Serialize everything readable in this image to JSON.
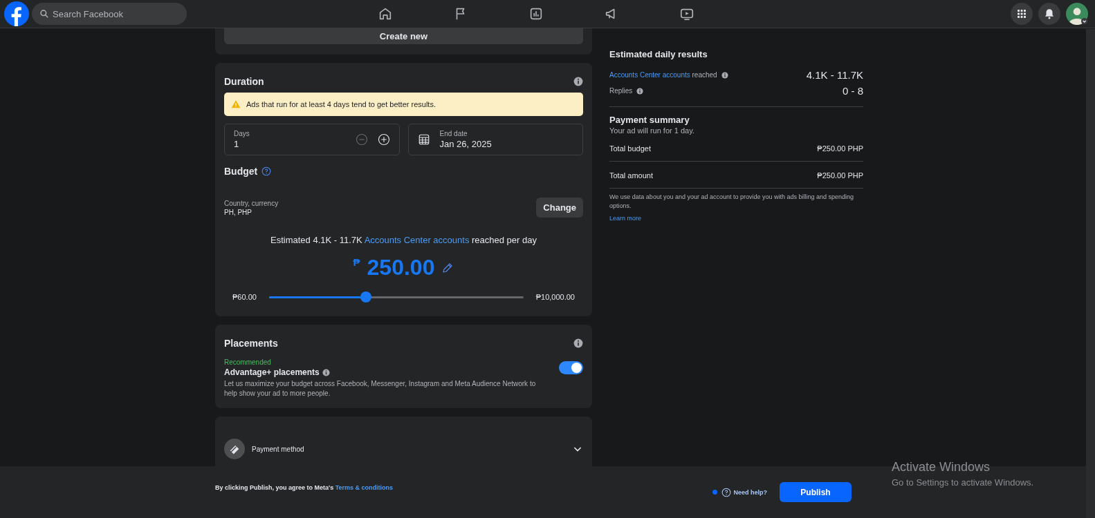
{
  "topbar": {
    "search": {
      "placeholder": "Search Facebook"
    }
  },
  "create_new_button": "Create new",
  "duration": {
    "title": "Duration",
    "warning": "Ads that run for at least 4 days tend to get better results.",
    "days": {
      "label": "Days",
      "value": "1",
      "decrement_disabled": true
    },
    "end_date": {
      "label": "End date",
      "value": "Jan 26, 2025"
    }
  },
  "budget": {
    "title": "Budget",
    "country_label": "Country, currency",
    "country_value": "PH, PHP",
    "change_button": "Change",
    "estimate": {
      "before": "Estimated 4.1K - 11.7K",
      "link": "Accounts Center accounts",
      "after": "reached per day"
    },
    "currency_symbol": "₱",
    "amount": "250.00",
    "slider": {
      "min_label": "₱60.00",
      "max_label": "₱10,000.00",
      "level": 0.38
    }
  },
  "placements": {
    "title": "Placements",
    "recommended": "Recommended",
    "option_title": "Advantage+ placements",
    "description": "Let us maximize your budget across Facebook, Messenger, Instagram and Meta Audience Network to help show your ad to more people.",
    "on": true
  },
  "payment_method": {
    "label": "Payment method"
  },
  "estimated_daily_results": {
    "title": "Estimated daily results",
    "rows": [
      {
        "link": "Accounts Center accounts",
        "label": "reached",
        "value": "4.1K - 11.7K"
      },
      {
        "label": "Replies",
        "value": "0 - 8"
      }
    ]
  },
  "payment_summary": {
    "title": "Payment summary",
    "subtitle": "Your ad will run for 1 day.",
    "rows": [
      {
        "label": "Total budget",
        "value": "₱250.00 PHP"
      },
      {
        "label": "Total amount",
        "value": "₱250.00 PHP"
      }
    ],
    "notice": "We use data about you and your ad account to provide you with ads billing and spending options.",
    "learn_more": "Learn more"
  },
  "footer": {
    "agreement": "By clicking Publish, you agree to Meta's",
    "terms_link": "Terms & conditions",
    "help": "Need help?",
    "publish_button": "Publish"
  },
  "os_overlay": {
    "title": "Activate Windows",
    "subtitle": "Go to Settings to activate Windows."
  }
}
